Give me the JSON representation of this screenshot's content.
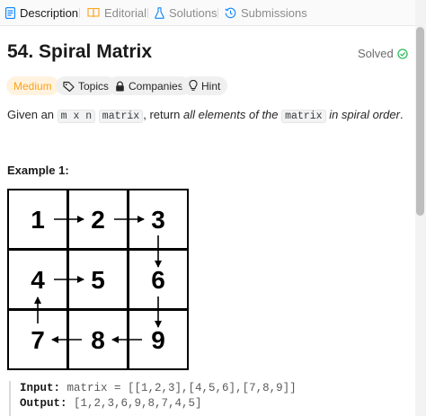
{
  "tabs": [
    {
      "label": "Description",
      "icon": "document-icon",
      "active": true
    },
    {
      "label": "Editorial",
      "icon": "book-icon",
      "active": false
    },
    {
      "label": "Solutions",
      "icon": "flask-icon",
      "active": false
    },
    {
      "label": "Submissions",
      "icon": "history-icon",
      "active": false
    }
  ],
  "problem": {
    "title": "54. Spiral Matrix",
    "status": "Solved",
    "status_color": "#2cbb5d"
  },
  "chips": {
    "difficulty": "Medium",
    "difficulty_color": "#ffa116",
    "topics": "Topics",
    "companies": "Companies",
    "hint": "Hint"
  },
  "description": {
    "part1": "Given an ",
    "code1": "m x n",
    "part2": " ",
    "code2": "matrix",
    "part3": ", return ",
    "italic1": "all elements of the",
    "part4": " ",
    "code3": "matrix",
    "part5": " ",
    "italic2": "in spiral order",
    "part6": "."
  },
  "example": {
    "title": "Example 1:",
    "matrix": [
      [
        "1",
        "2",
        "3"
      ],
      [
        "4",
        "5",
        "6"
      ],
      [
        "7",
        "8",
        "9"
      ]
    ],
    "input_label": "Input:",
    "input_value": "matrix = [[1,2,3],[4,5,6],[7,8,9]]",
    "output_label": "Output:",
    "output_value": "[1,2,3,6,9,8,7,4,5]"
  }
}
